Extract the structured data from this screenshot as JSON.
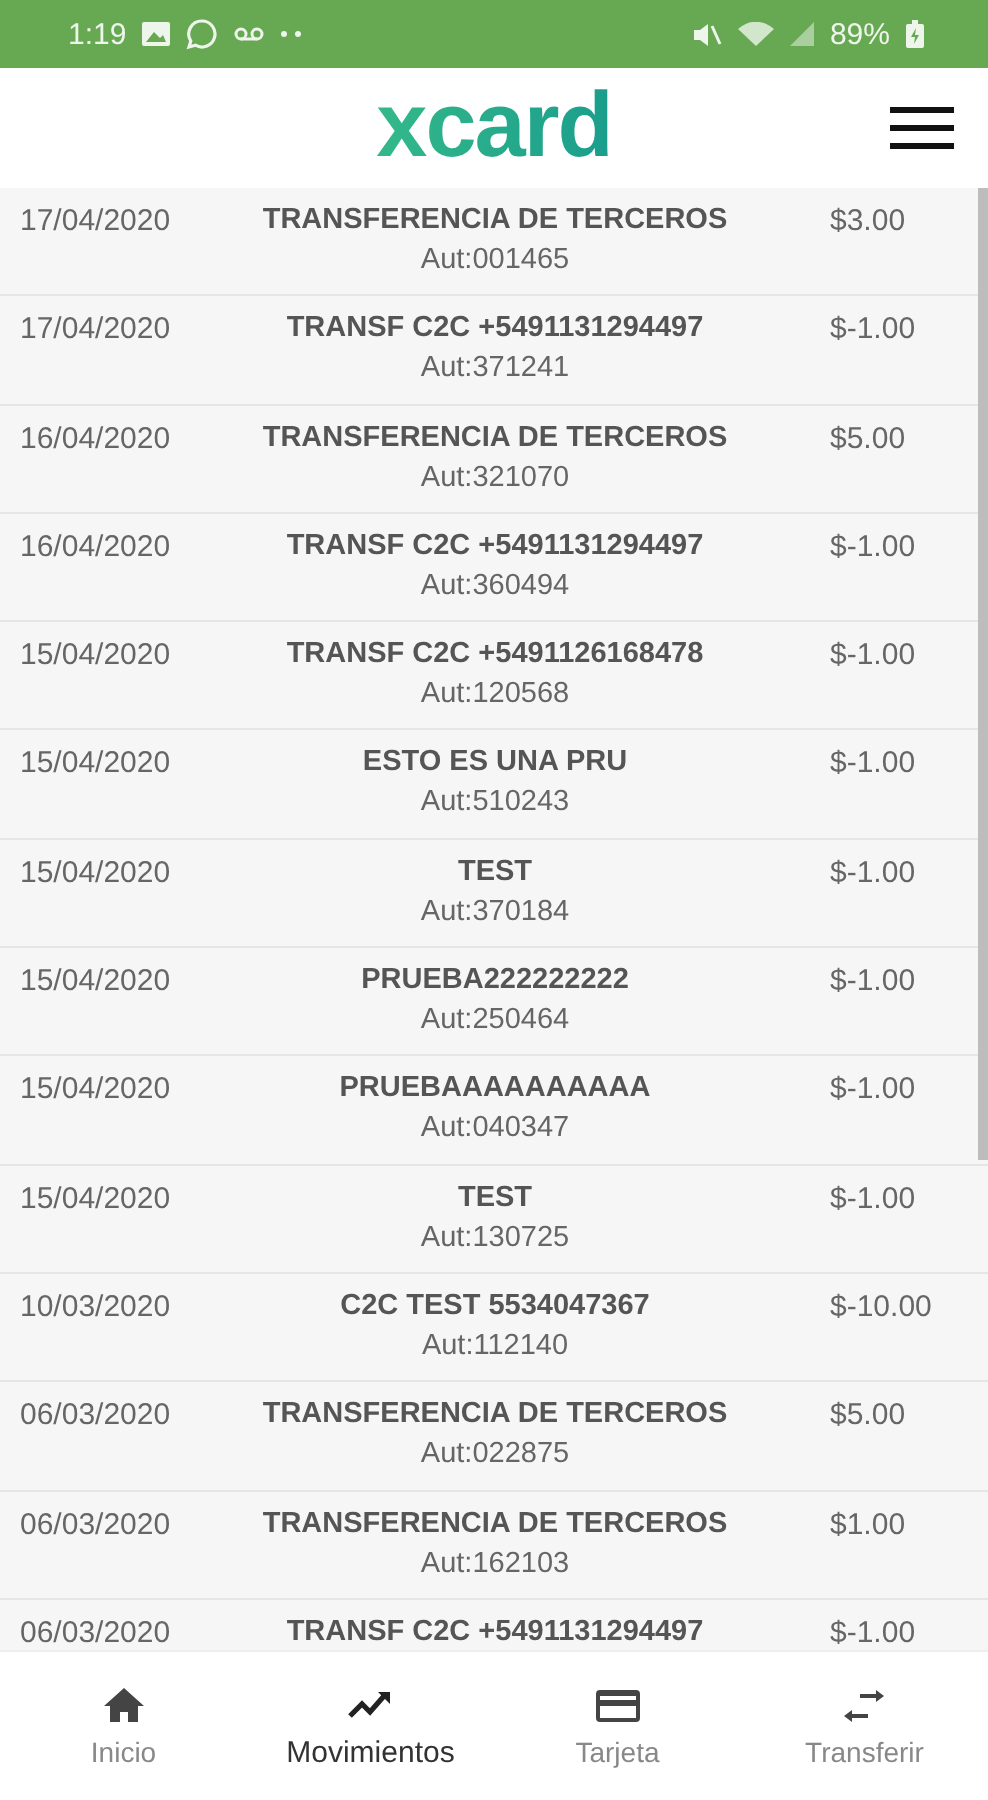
{
  "status_bar": {
    "time": "1:19",
    "battery": "89%"
  },
  "header": {
    "logo": "xcard"
  },
  "movements": [
    {
      "date": "17/04/2020",
      "description": "TRANSFERENCIA DE TERCEROS",
      "auth": "Aut:001465",
      "amount": "$3.00"
    },
    {
      "date": "17/04/2020",
      "description": "TRANSF C2C +5491131294497",
      "auth": "Aut:371241",
      "amount": "$-1.00"
    },
    {
      "date": "16/04/2020",
      "description": "TRANSFERENCIA DE TERCEROS",
      "auth": "Aut:321070",
      "amount": "$5.00"
    },
    {
      "date": "16/04/2020",
      "description": "TRANSF C2C +5491131294497",
      "auth": "Aut:360494",
      "amount": "$-1.00"
    },
    {
      "date": "15/04/2020",
      "description": "TRANSF C2C +5491126168478",
      "auth": "Aut:120568",
      "amount": "$-1.00"
    },
    {
      "date": "15/04/2020",
      "description": "ESTO ES UNA PRU",
      "auth": "Aut:510243",
      "amount": "$-1.00"
    },
    {
      "date": "15/04/2020",
      "description": "TEST",
      "auth": "Aut:370184",
      "amount": "$-1.00"
    },
    {
      "date": "15/04/2020",
      "description": "PRUEBA222222222",
      "auth": "Aut:250464",
      "amount": "$-1.00"
    },
    {
      "date": "15/04/2020",
      "description": "PRUEBAAAAAAAAAA",
      "auth": "Aut:040347",
      "amount": "$-1.00"
    },
    {
      "date": "15/04/2020",
      "description": "TEST",
      "auth": "Aut:130725",
      "amount": "$-1.00"
    },
    {
      "date": "10/03/2020",
      "description": "C2C TEST 5534047367",
      "auth": "Aut:112140",
      "amount": "$-10.00"
    },
    {
      "date": "06/03/2020",
      "description": "TRANSFERENCIA DE TERCEROS",
      "auth": "Aut:022875",
      "amount": "$5.00"
    },
    {
      "date": "06/03/2020",
      "description": "TRANSFERENCIA DE TERCEROS",
      "auth": "Aut:162103",
      "amount": "$1.00"
    },
    {
      "date": "06/03/2020",
      "description": "TRANSF C2C +5491131294497",
      "amount": "$-1.00"
    }
  ],
  "bottom_nav": [
    {
      "kind": "home",
      "label": "Inicio",
      "selected": false
    },
    {
      "kind": "trend",
      "label": "Movimientos",
      "selected": true
    },
    {
      "kind": "card",
      "label": "Tarjeta",
      "selected": false
    },
    {
      "kind": "transfer",
      "label": "Transferir",
      "selected": false
    }
  ]
}
